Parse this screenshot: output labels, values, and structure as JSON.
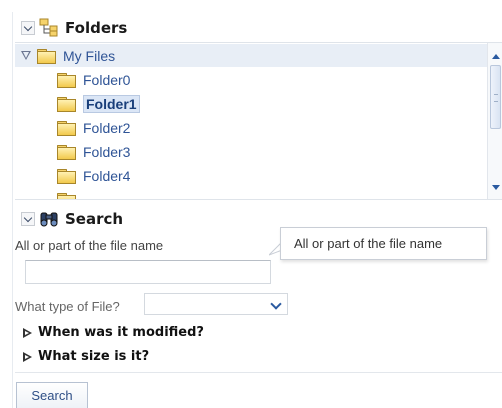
{
  "folders": {
    "title": "Folders",
    "root_label": "My Files",
    "items": [
      {
        "label": "Folder0",
        "selected": false
      },
      {
        "label": "Folder1",
        "selected": true
      },
      {
        "label": "Folder2",
        "selected": false
      },
      {
        "label": "Folder3",
        "selected": false
      },
      {
        "label": "Folder4",
        "selected": false
      }
    ]
  },
  "search": {
    "title": "Search",
    "name_label": "All or part of the file name",
    "name_value": "",
    "type_label": "What type of File?",
    "type_value": "",
    "modified_label": "When was it modified?",
    "size_label": "What size is it?",
    "button_label": "Search"
  },
  "tooltip": {
    "text": "All or part of the file name"
  },
  "colors": {
    "accent": "#2a5aa0",
    "link_text": "#2f5496",
    "selection_bg": "#dbe6f6"
  },
  "icons": {
    "folders_header": "folder-tree-icon",
    "search_header": "binoculars-icon",
    "tree_item": "folder-icon"
  }
}
